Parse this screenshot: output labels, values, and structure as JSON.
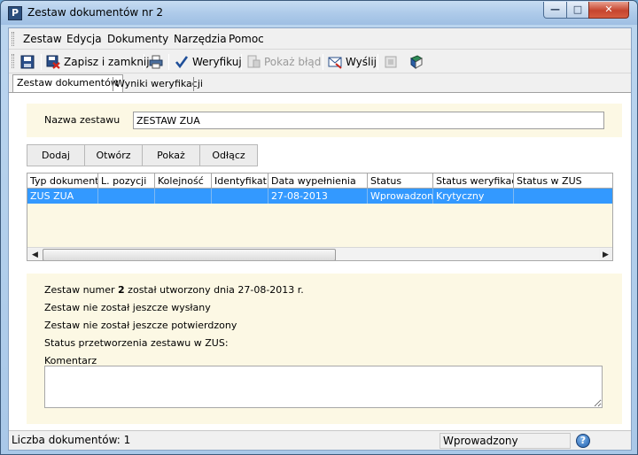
{
  "window": {
    "title": "Zestaw dokumentów nr 2",
    "app_icon_letter": "P",
    "min_glyph": "—",
    "max_glyph": "□",
    "close_glyph": "✕"
  },
  "menu": {
    "items": [
      "Zestaw",
      "Edycja",
      "Dokumenty",
      "Narzędzia",
      "Pomoc"
    ]
  },
  "toolbar": {
    "save_close_label": "Zapisz i zamknij",
    "verify_label": "Weryfikuj",
    "show_error_label": "Pokaż błąd",
    "send_label": "Wyślij"
  },
  "tabs": {
    "items": [
      "Zestaw dokumentów",
      "Wyniki weryfikacji"
    ]
  },
  "form": {
    "name_label": "Nazwa zestawu",
    "name_value": "ZESTAW ZUA"
  },
  "buttons": {
    "add": "Dodaj",
    "open": "Otwórz",
    "show": "Pokaż",
    "detach": "Odłącz"
  },
  "grid": {
    "columns": [
      "Typ dokumentu",
      "L. pozycji",
      "Kolejność",
      "Identyfikat...",
      "Data wypełnienia",
      "Status",
      "Status weryfikacji",
      "Status w ZUS"
    ],
    "rows": [
      [
        "ZUS ZUA",
        "",
        "",
        "",
        "27-08-2013",
        "Wprowadzony",
        "Krytyczny",
        ""
      ]
    ],
    "scroll_left": "◀",
    "scroll_right": "▶"
  },
  "info": {
    "created_prefix": "Zestaw numer ",
    "created_number": "2",
    "created_suffix": " został utworzony dnia 27-08-2013 r.",
    "not_sent": "Zestaw nie został jeszcze wysłany",
    "not_confirmed": "Zestaw nie został jeszcze potwierdzony",
    "zus_status": "Status przetworzenia zestawu w ZUS:",
    "comment_label": "Komentarz",
    "comment_value": ""
  },
  "statusbar": {
    "doc_count": "Liczba dokumentów: 1",
    "status": "Wprowadzony",
    "help_glyph": "?"
  }
}
